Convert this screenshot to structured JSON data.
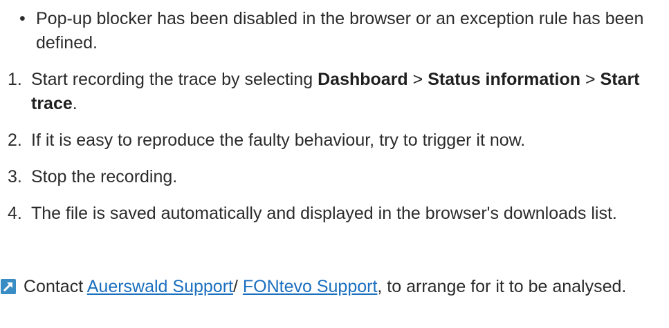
{
  "prerequisite": {
    "bullet": "•",
    "text": "Pop-up blocker has been disabled in the browser or an exception rule has been defined."
  },
  "steps": [
    {
      "number": "1.",
      "text_before": "Start recording the trace by selecting ",
      "menu_1": "Dashboard",
      "sep_1": " > ",
      "menu_2": "Status information",
      "sep_2": " > ",
      "menu_3": "Start trace",
      "text_after": "."
    },
    {
      "number": "2.",
      "text": "If it is easy to reproduce the faulty behaviour, try to trigger it now."
    },
    {
      "number": "3.",
      "text": "Stop the recording."
    },
    {
      "number": "4.",
      "text": "The file is saved automatically and displayed in the browser's downloads list."
    }
  ],
  "result": {
    "icon": "arrow-up-right-icon",
    "icon_color": "#3a8cc4",
    "text_before": "Contact ",
    "link_1": "Auerswald Support",
    "separator": "/ ",
    "link_2": "FONtevo Support",
    "text_after": ", to arrange for it to be analysed."
  },
  "colors": {
    "text": "#2b2b2b",
    "link": "#1a6fbf"
  }
}
